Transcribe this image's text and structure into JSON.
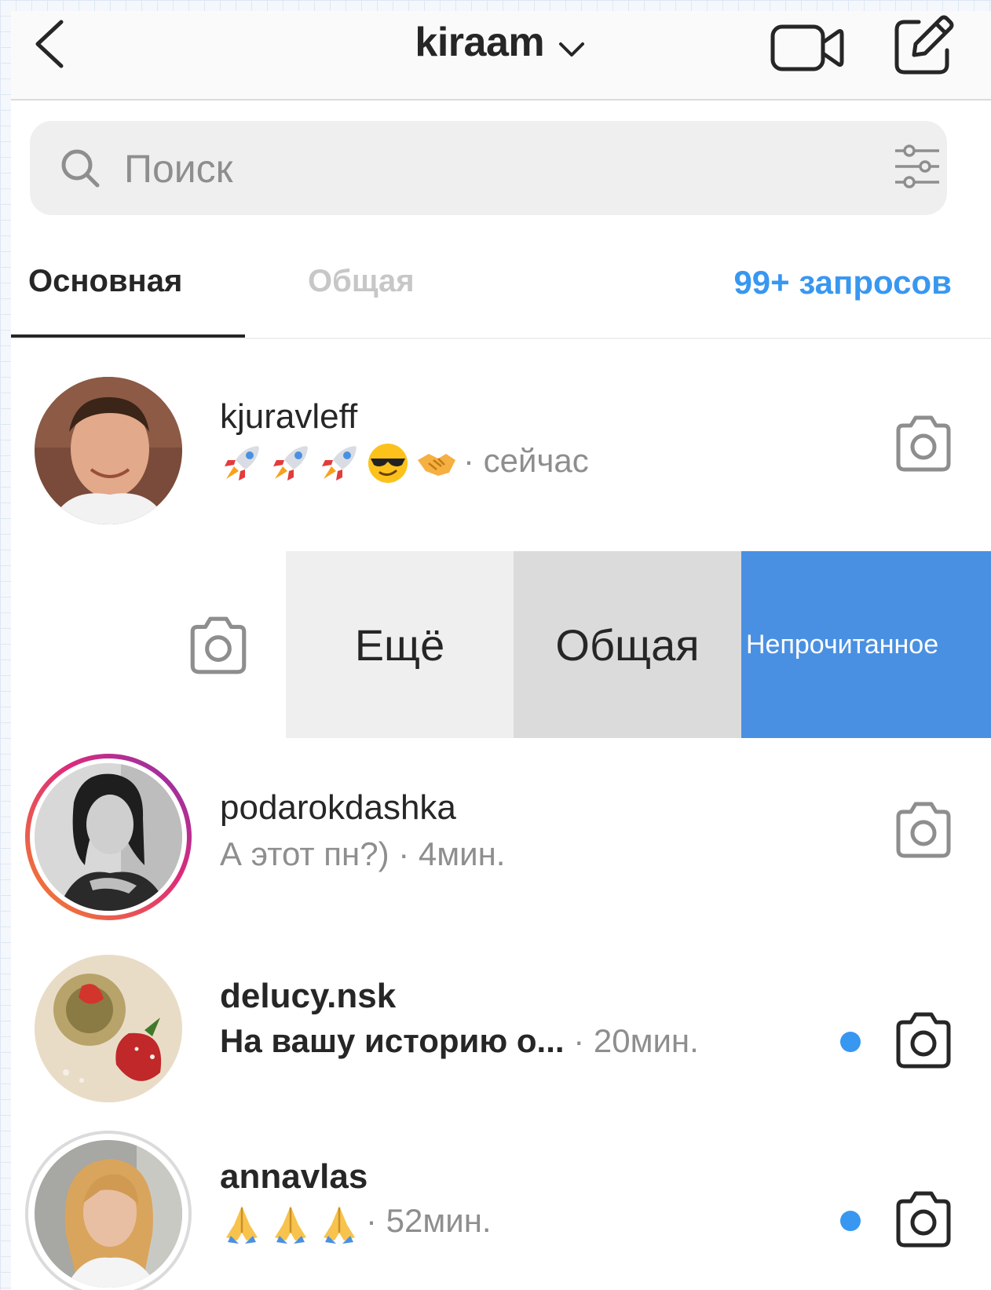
{
  "header": {
    "title": "kiraam"
  },
  "search": {
    "placeholder": "Поиск"
  },
  "tabs": {
    "primary": "Основная",
    "general": "Общая",
    "requests": "99+ запросов"
  },
  "threads": [
    {
      "username": "kjuravleff",
      "preview_emojis": [
        "rocket",
        "rocket",
        "rocket",
        "smiling-face-with-sunglasses",
        "handshake"
      ],
      "time": "· сейчас",
      "unread": false
    },
    {
      "swiped": true,
      "actions": {
        "more": "Ещё",
        "general": "Общая",
        "unread": "Непрочитанное"
      }
    },
    {
      "username": "podarokdashka",
      "preview": "А этот пн?)",
      "time": "· 4мин.",
      "unread": false,
      "story_ring": true
    },
    {
      "username": "delucy.nsk",
      "preview": "На вашу историю о...",
      "time": "· 20мин.",
      "unread": true
    },
    {
      "username": "annavlas",
      "preview_emojis": [
        "folded-hands",
        "folded-hands",
        "folded-hands"
      ],
      "time": "· 52мин.",
      "unread": true,
      "story_ring": "seen"
    }
  ],
  "colors": {
    "accent": "#3897f0",
    "unread_action": "#4a90e2",
    "muted_text": "#8e8e8e",
    "story_ring_start": "#f58529",
    "story_ring_end": "#8134af"
  }
}
